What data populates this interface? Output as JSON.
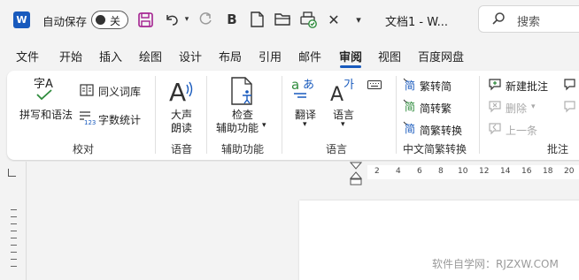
{
  "titlebar": {
    "logo_letter": "W",
    "autosave_label": "自动保存",
    "autosave_state": "关",
    "doc_title": "文档1 - W...",
    "search_placeholder": "搜索"
  },
  "tabs": [
    {
      "label": "文件"
    },
    {
      "label": "开始"
    },
    {
      "label": "插入"
    },
    {
      "label": "绘图"
    },
    {
      "label": "设计"
    },
    {
      "label": "布局"
    },
    {
      "label": "引用"
    },
    {
      "label": "邮件"
    },
    {
      "label": "审阅",
      "active": true
    },
    {
      "label": "视图"
    },
    {
      "label": "百度网盘"
    }
  ],
  "ribbon": {
    "proofing": {
      "label": "校对",
      "spelling": "拼写和语法",
      "spelling_icon_text": "字A",
      "thesaurus": "同义词库",
      "word_count": "字数统计",
      "word_count_icon_text": "123"
    },
    "speech": {
      "label": "语音",
      "read_aloud_line1": "大声",
      "read_aloud_line2": "朗读"
    },
    "accessibility": {
      "label": "辅助功能",
      "check_line1": "检查",
      "check_line2": "辅助功能"
    },
    "language": {
      "label": "语言",
      "translate": "翻译",
      "language": "语言",
      "translate_icon_a": "a",
      "translate_icon_b": "あ",
      "language_icon_a": "A",
      "language_icon_b": "가"
    },
    "chinese_conversion": {
      "label": "中文简繁转换",
      "to_traditional": "繁转简",
      "to_simplified": "简转繁",
      "convert": "简繁转换",
      "icon_glyph": "简"
    },
    "comments": {
      "label": "批注",
      "new_comment": "新建批注",
      "delete": "删除",
      "previous": "上一条"
    }
  },
  "ruler": {
    "numbers": [
      "2",
      "4",
      "6",
      "8",
      "10",
      "12",
      "14",
      "16",
      "18",
      "20"
    ]
  },
  "watermark": "软件自学网：RJZXW.COM"
}
